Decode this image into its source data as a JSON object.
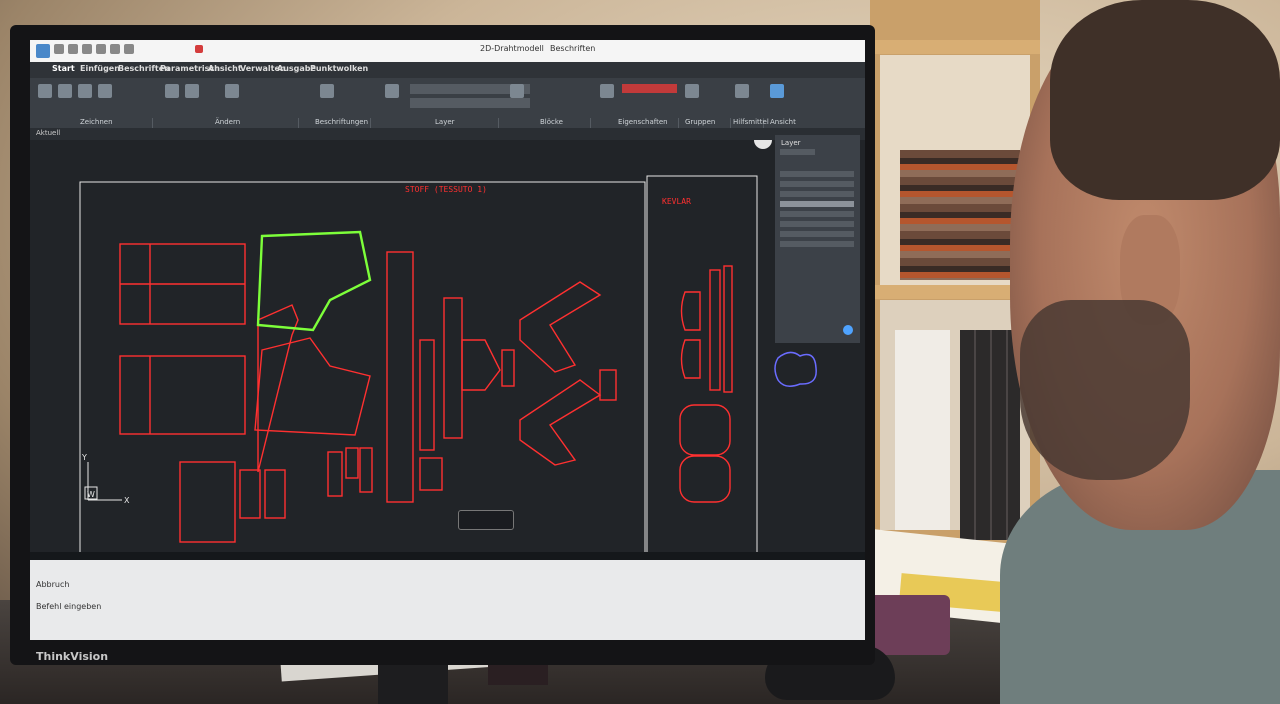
{
  "monitor": {
    "brand": "ThinkVision"
  },
  "app": {
    "toolbar_title": "2D-Drahtmodell",
    "workspace": "Beschriften",
    "menu_tabs": [
      "Start",
      "Einfügen",
      "Beschriften",
      "Parametrisch",
      "Ansicht",
      "Verwalten",
      "Ausgabe",
      "Punktwolken"
    ],
    "ribbon_groups": [
      "Zeichnen",
      "Ändern",
      "Beschriftungen",
      "Layer",
      "Blöcke",
      "Eigenschaften",
      "Gruppen",
      "Hilfsmittel",
      "Ansicht"
    ],
    "file_tab": "Aktuell",
    "command_history": "Abbruch",
    "command_prompt": "Befehl eingeben"
  },
  "drawing": {
    "sheet_label_1": "STOFF (TESSUTO 1)",
    "sheet_label_2": "KEVLAR",
    "ucs_x": "X",
    "ucs_y": "Y",
    "ucs_w": "W"
  },
  "layer_panel": {
    "title": "Layer"
  },
  "colors": {
    "pattern_stroke": "#ff3030",
    "selected_stroke": "#7dff3a",
    "outline": "#e6e6e6",
    "accent_blue": "#6a6cff"
  }
}
